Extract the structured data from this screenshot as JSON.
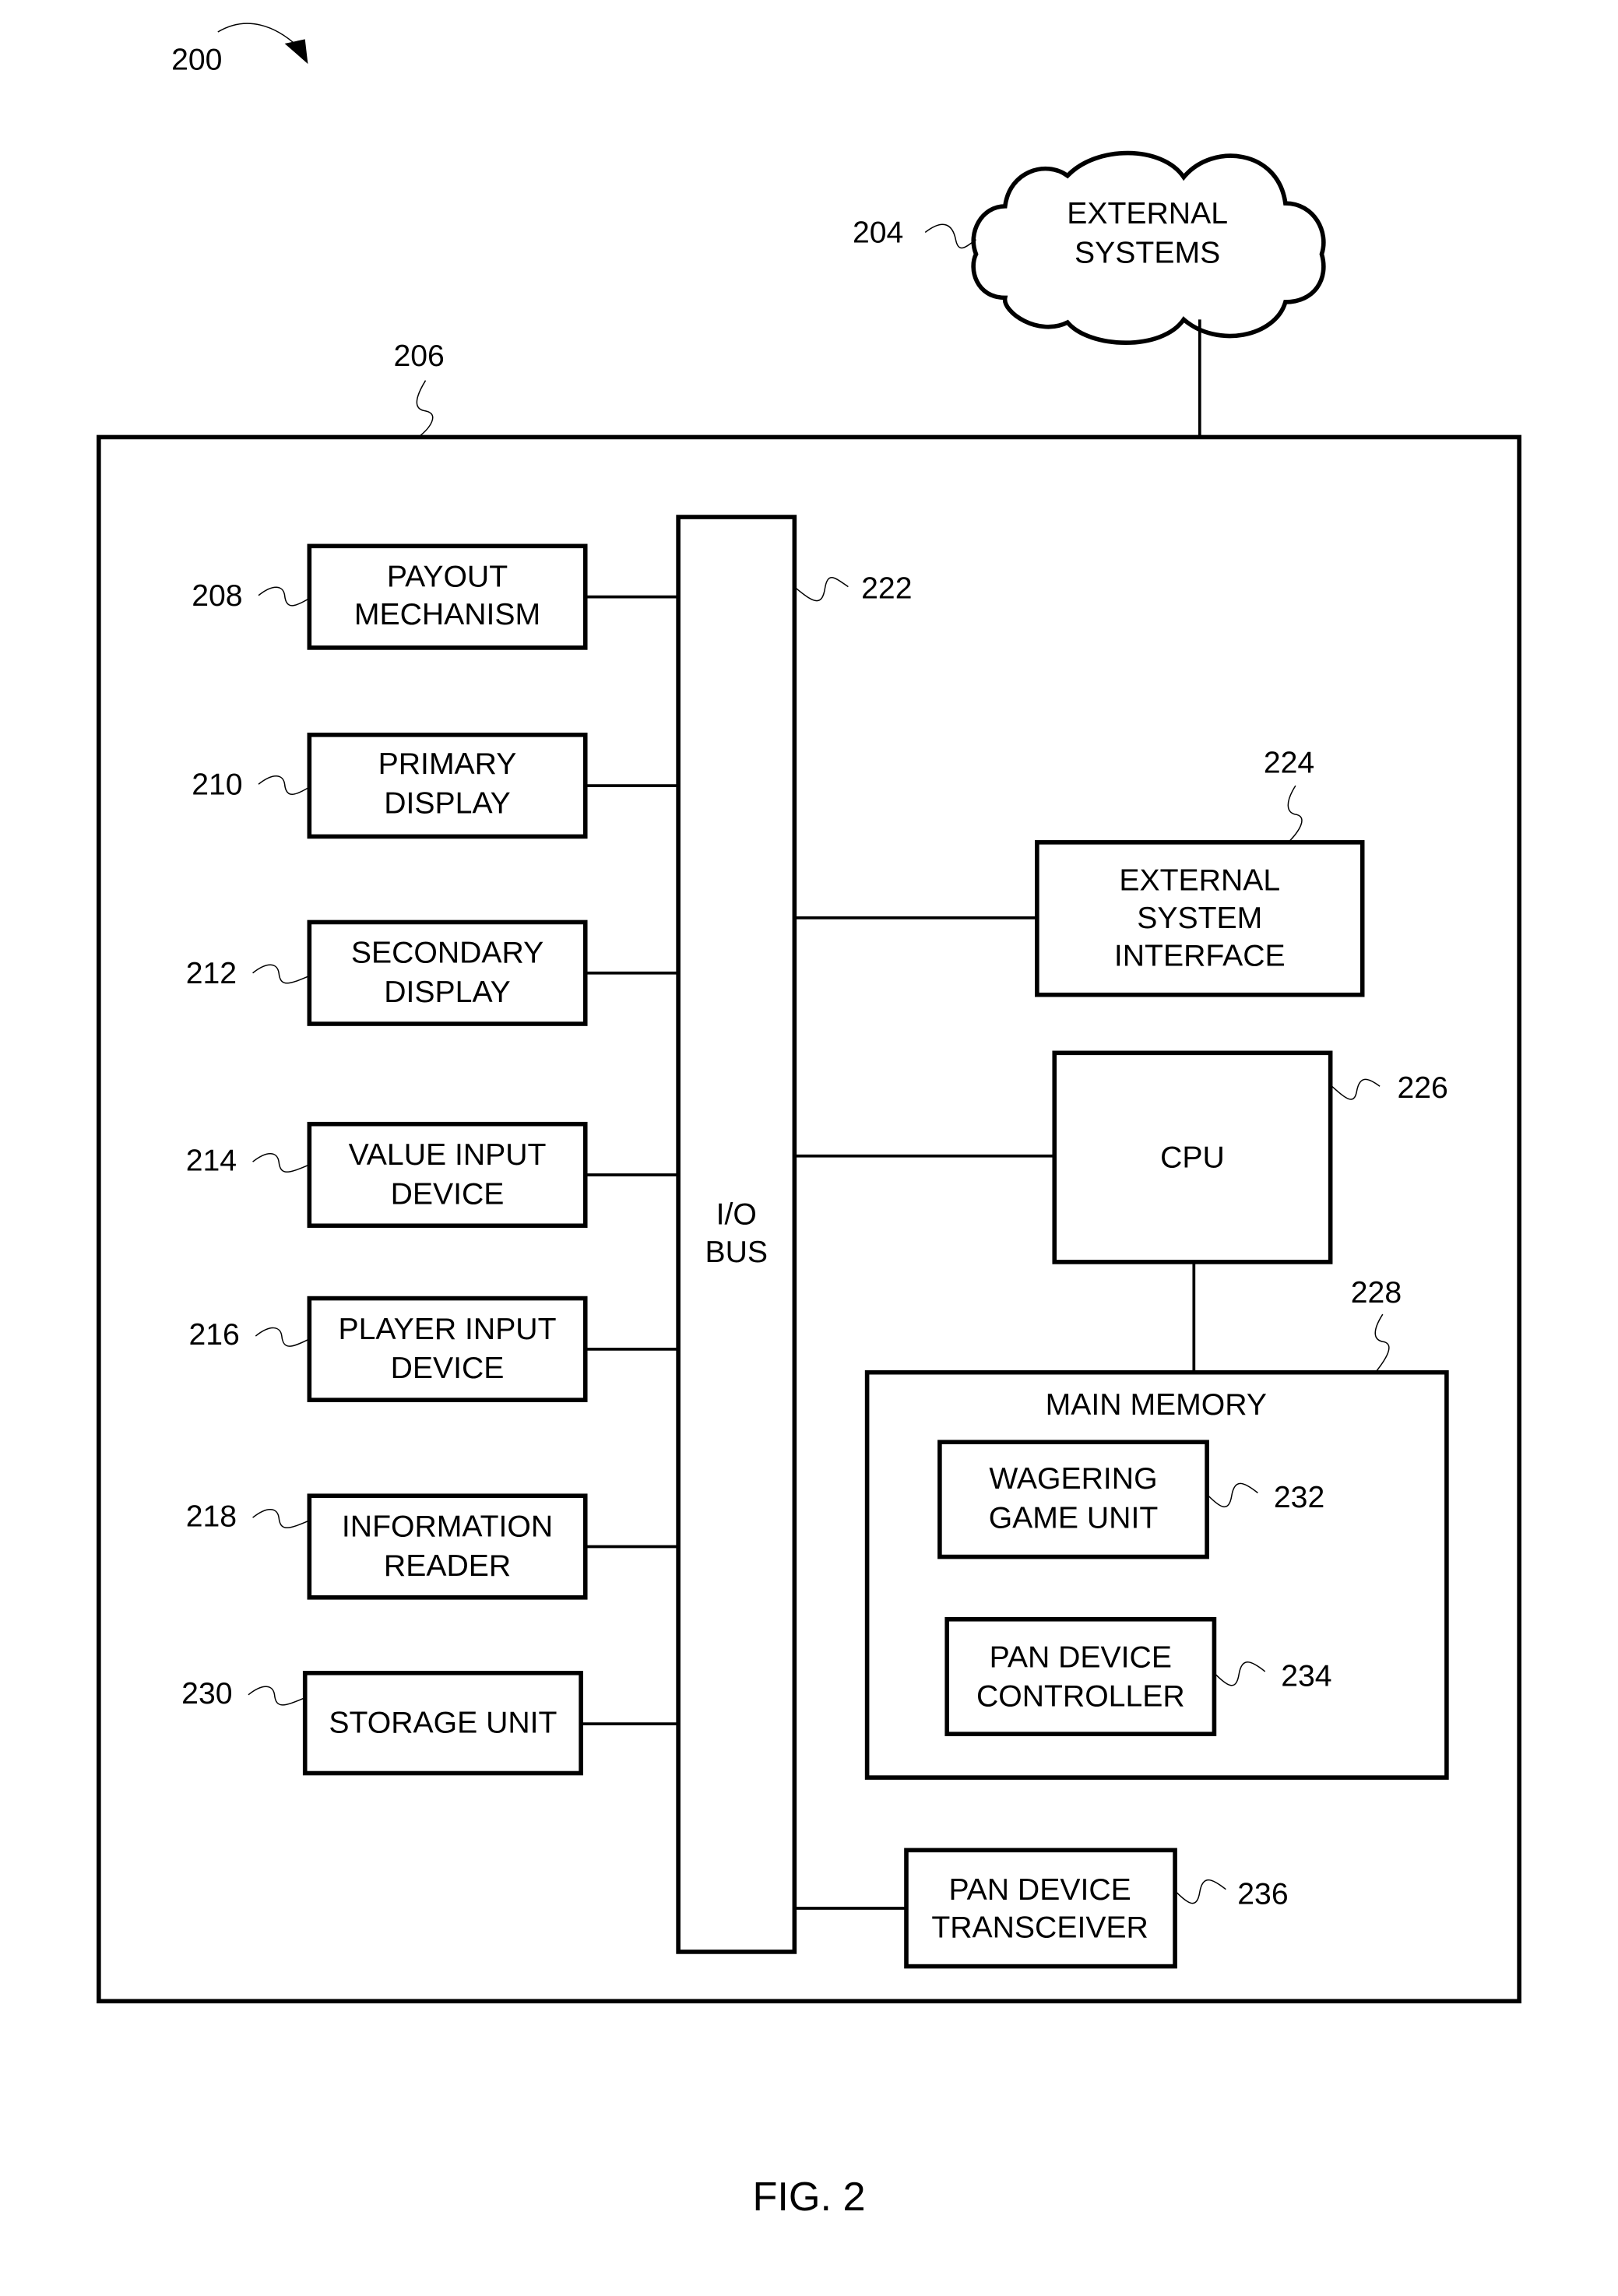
{
  "figure": {
    "ref": "200",
    "caption": "FIG. 2"
  },
  "external_systems": {
    "ref": "204",
    "lines": [
      "EXTERNAL",
      "SYSTEMS"
    ]
  },
  "machine": {
    "ref": "206"
  },
  "left_components": [
    {
      "id": "payout",
      "ref": "208",
      "lines": [
        "PAYOUT",
        "MECHANISM"
      ]
    },
    {
      "id": "primary-display",
      "ref": "210",
      "lines": [
        "PRIMARY",
        "DISPLAY"
      ]
    },
    {
      "id": "secondary-display",
      "ref": "212",
      "lines": [
        "SECONDARY",
        "DISPLAY"
      ]
    },
    {
      "id": "value-input",
      "ref": "214",
      "lines": [
        "VALUE INPUT",
        "DEVICE"
      ]
    },
    {
      "id": "player-input",
      "ref": "216",
      "lines": [
        "PLAYER INPUT",
        "DEVICE"
      ]
    },
    {
      "id": "information-reader",
      "ref": "218",
      "lines": [
        "INFORMATION",
        "READER"
      ]
    },
    {
      "id": "storage-unit",
      "ref": "230",
      "lines": [
        "STORAGE UNIT"
      ]
    }
  ],
  "io_bus": {
    "ref": "222",
    "lines": [
      "I/O",
      "BUS"
    ]
  },
  "external_interface": {
    "ref": "224",
    "lines": [
      "EXTERNAL",
      "SYSTEM",
      "INTERFACE"
    ]
  },
  "cpu": {
    "ref": "226",
    "lines": [
      "CPU"
    ]
  },
  "main_memory": {
    "ref": "228",
    "title": "MAIN MEMORY"
  },
  "wagering_unit": {
    "ref": "232",
    "lines": [
      "WAGERING",
      "GAME UNIT"
    ]
  },
  "pan_controller": {
    "ref": "234",
    "lines": [
      "PAN DEVICE",
      "CONTROLLER"
    ]
  },
  "pan_transceiver": {
    "ref": "236",
    "lines": [
      "PAN DEVICE",
      "TRANSCEIVER"
    ]
  }
}
